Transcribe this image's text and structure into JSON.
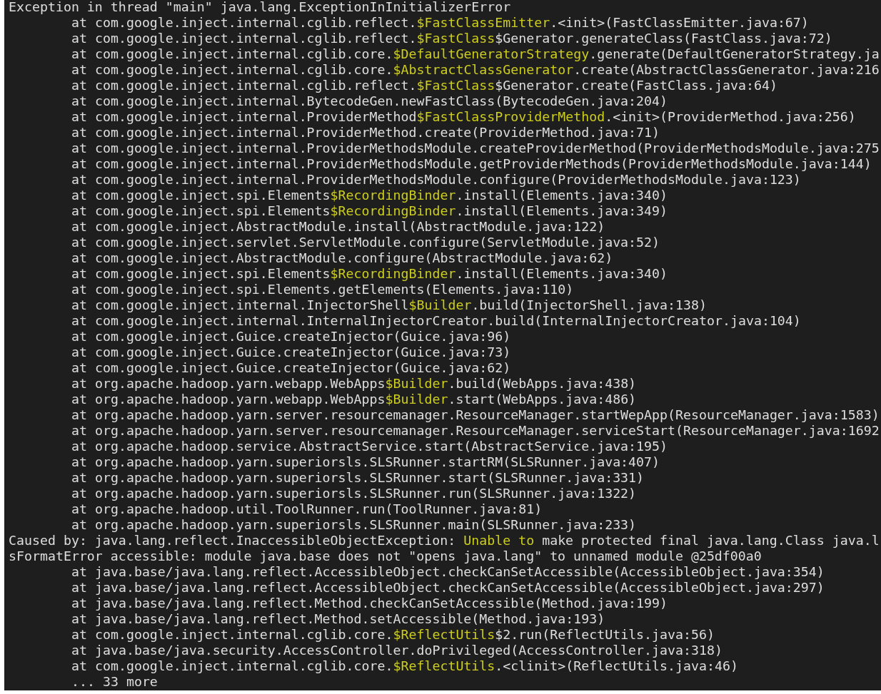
{
  "terminal": {
    "lines": [
      {
        "kind": "header",
        "parts": [
          {
            "text": "Exception in thread \"main\" java.lang.ExceptionInInitializerError",
            "highlight": false
          }
        ]
      },
      {
        "kind": "frame",
        "parts": [
          {
            "text": "at com.google.inject.internal.cglib.reflect.",
            "highlight": false
          },
          {
            "text": "$FastClassEmitter",
            "highlight": true
          },
          {
            "text": ".<init>(FastClassEmitter.java:67)",
            "highlight": false
          }
        ]
      },
      {
        "kind": "frame",
        "parts": [
          {
            "text": "at com.google.inject.internal.cglib.reflect.",
            "highlight": false
          },
          {
            "text": "$FastClass",
            "highlight": true
          },
          {
            "text": "$Generator.generateClass(FastClass.java:72)",
            "highlight": false
          }
        ]
      },
      {
        "kind": "frame",
        "parts": [
          {
            "text": "at com.google.inject.internal.cglib.core.",
            "highlight": false
          },
          {
            "text": "$DefaultGeneratorStrategy",
            "highlight": true
          },
          {
            "text": ".generate(DefaultGeneratorStrategy.ja",
            "highlight": false
          }
        ]
      },
      {
        "kind": "frame",
        "parts": [
          {
            "text": "at com.google.inject.internal.cglib.core.",
            "highlight": false
          },
          {
            "text": "$AbstractClassGenerator",
            "highlight": true
          },
          {
            "text": ".create(AbstractClassGenerator.java:216",
            "highlight": false
          }
        ]
      },
      {
        "kind": "frame",
        "parts": [
          {
            "text": "at com.google.inject.internal.cglib.reflect.",
            "highlight": false
          },
          {
            "text": "$FastClass",
            "highlight": true
          },
          {
            "text": "$Generator.create(FastClass.java:64)",
            "highlight": false
          }
        ]
      },
      {
        "kind": "frame",
        "parts": [
          {
            "text": "at com.google.inject.internal.BytecodeGen.newFastClass(BytecodeGen.java:204)",
            "highlight": false
          }
        ]
      },
      {
        "kind": "frame",
        "parts": [
          {
            "text": "at com.google.inject.internal.ProviderMethod",
            "highlight": false
          },
          {
            "text": "$FastClassProviderMethod",
            "highlight": true
          },
          {
            "text": ".<init>(ProviderMethod.java:256)",
            "highlight": false
          }
        ]
      },
      {
        "kind": "frame",
        "parts": [
          {
            "text": "at com.google.inject.internal.ProviderMethod.create(ProviderMethod.java:71)",
            "highlight": false
          }
        ]
      },
      {
        "kind": "frame",
        "parts": [
          {
            "text": "at com.google.inject.internal.ProviderMethodsModule.createProviderMethod(ProviderMethodsModule.java:275",
            "highlight": false
          }
        ]
      },
      {
        "kind": "frame",
        "parts": [
          {
            "text": "at com.google.inject.internal.ProviderMethodsModule.getProviderMethods(ProviderMethodsModule.java:144)",
            "highlight": false
          }
        ]
      },
      {
        "kind": "frame",
        "parts": [
          {
            "text": "at com.google.inject.internal.ProviderMethodsModule.configure(ProviderMethodsModule.java:123)",
            "highlight": false
          }
        ]
      },
      {
        "kind": "frame",
        "parts": [
          {
            "text": "at com.google.inject.spi.Elements",
            "highlight": false
          },
          {
            "text": "$RecordingBinder",
            "highlight": true
          },
          {
            "text": ".install(Elements.java:340)",
            "highlight": false
          }
        ]
      },
      {
        "kind": "frame",
        "parts": [
          {
            "text": "at com.google.inject.spi.Elements",
            "highlight": false
          },
          {
            "text": "$RecordingBinder",
            "highlight": true
          },
          {
            "text": ".install(Elements.java:349)",
            "highlight": false
          }
        ]
      },
      {
        "kind": "frame",
        "parts": [
          {
            "text": "at com.google.inject.AbstractModule.install(AbstractModule.java:122)",
            "highlight": false
          }
        ]
      },
      {
        "kind": "frame",
        "parts": [
          {
            "text": "at com.google.inject.servlet.ServletModule.configure(ServletModule.java:52)",
            "highlight": false
          }
        ]
      },
      {
        "kind": "frame",
        "parts": [
          {
            "text": "at com.google.inject.AbstractModule.configure(AbstractModule.java:62)",
            "highlight": false
          }
        ]
      },
      {
        "kind": "frame",
        "parts": [
          {
            "text": "at com.google.inject.spi.Elements",
            "highlight": false
          },
          {
            "text": "$RecordingBinder",
            "highlight": true
          },
          {
            "text": ".install(Elements.java:340)",
            "highlight": false
          }
        ]
      },
      {
        "kind": "frame",
        "parts": [
          {
            "text": "at com.google.inject.spi.Elements.getElements(Elements.java:110)",
            "highlight": false
          }
        ]
      },
      {
        "kind": "frame",
        "parts": [
          {
            "text": "at com.google.inject.internal.InjectorShell",
            "highlight": false
          },
          {
            "text": "$Builder",
            "highlight": true
          },
          {
            "text": ".build(InjectorShell.java:138)",
            "highlight": false
          }
        ]
      },
      {
        "kind": "frame",
        "parts": [
          {
            "text": "at com.google.inject.internal.InternalInjectorCreator.build(InternalInjectorCreator.java:104)",
            "highlight": false
          }
        ]
      },
      {
        "kind": "frame",
        "parts": [
          {
            "text": "at com.google.inject.Guice.createInjector(Guice.java:96)",
            "highlight": false
          }
        ]
      },
      {
        "kind": "frame",
        "parts": [
          {
            "text": "at com.google.inject.Guice.createInjector(Guice.java:73)",
            "highlight": false
          }
        ]
      },
      {
        "kind": "frame",
        "parts": [
          {
            "text": "at com.google.inject.Guice.createInjector(Guice.java:62)",
            "highlight": false
          }
        ]
      },
      {
        "kind": "frame",
        "parts": [
          {
            "text": "at org.apache.hadoop.yarn.webapp.WebApps",
            "highlight": false
          },
          {
            "text": "$Builder",
            "highlight": true
          },
          {
            "text": ".build(WebApps.java:438)",
            "highlight": false
          }
        ]
      },
      {
        "kind": "frame",
        "parts": [
          {
            "text": "at org.apache.hadoop.yarn.webapp.WebApps",
            "highlight": false
          },
          {
            "text": "$Builder",
            "highlight": true
          },
          {
            "text": ".start(WebApps.java:486)",
            "highlight": false
          }
        ]
      },
      {
        "kind": "frame",
        "parts": [
          {
            "text": "at org.apache.hadoop.yarn.server.resourcemanager.ResourceManager.startWepApp(ResourceManager.java:1583)",
            "highlight": false
          }
        ]
      },
      {
        "kind": "frame",
        "parts": [
          {
            "text": "at org.apache.hadoop.yarn.server.resourcemanager.ResourceManager.serviceStart(ResourceManager.java:1692",
            "highlight": false
          }
        ]
      },
      {
        "kind": "frame",
        "parts": [
          {
            "text": "at org.apache.hadoop.service.AbstractService.start(AbstractService.java:195)",
            "highlight": false
          }
        ]
      },
      {
        "kind": "frame",
        "parts": [
          {
            "text": "at org.apache.hadoop.yarn.superiorsls.SLSRunner.startRM(SLSRunner.java:407)",
            "highlight": false
          }
        ]
      },
      {
        "kind": "frame",
        "parts": [
          {
            "text": "at org.apache.hadoop.yarn.superiorsls.SLSRunner.start(SLSRunner.java:331)",
            "highlight": false
          }
        ]
      },
      {
        "kind": "frame",
        "parts": [
          {
            "text": "at org.apache.hadoop.yarn.superiorsls.SLSRunner.run(SLSRunner.java:1322)",
            "highlight": false
          }
        ]
      },
      {
        "kind": "frame",
        "parts": [
          {
            "text": "at org.apache.hadoop.util.ToolRunner.run(ToolRunner.java:81)",
            "highlight": false
          }
        ]
      },
      {
        "kind": "frame",
        "parts": [
          {
            "text": "at org.apache.hadoop.yarn.superiorsls.SLSRunner.main(SLSRunner.java:233)",
            "highlight": false
          }
        ]
      },
      {
        "kind": "header",
        "parts": [
          {
            "text": "Caused by: java.lang.reflect.InaccessibleObjectException: ",
            "highlight": false
          },
          {
            "text": "Unable to",
            "highlight": true
          },
          {
            "text": " make protected final java.lang.Class java.l",
            "highlight": false
          }
        ]
      },
      {
        "kind": "header",
        "parts": [
          {
            "text": "sFormatError accessible: module java.base does not \"opens java.lang\" to unnamed module @25df00a0",
            "highlight": false
          }
        ]
      },
      {
        "kind": "frame",
        "parts": [
          {
            "text": "at java.base/java.lang.reflect.AccessibleObject.checkCanSetAccessible(AccessibleObject.java:354)",
            "highlight": false
          }
        ]
      },
      {
        "kind": "frame",
        "parts": [
          {
            "text": "at java.base/java.lang.reflect.AccessibleObject.checkCanSetAccessible(AccessibleObject.java:297)",
            "highlight": false
          }
        ]
      },
      {
        "kind": "frame",
        "parts": [
          {
            "text": "at java.base/java.lang.reflect.Method.checkCanSetAccessible(Method.java:199)",
            "highlight": false
          }
        ]
      },
      {
        "kind": "frame",
        "parts": [
          {
            "text": "at java.base/java.lang.reflect.Method.setAccessible(Method.java:193)",
            "highlight": false
          }
        ]
      },
      {
        "kind": "frame",
        "parts": [
          {
            "text": "at com.google.inject.internal.cglib.core.",
            "highlight": false
          },
          {
            "text": "$ReflectUtils",
            "highlight": true
          },
          {
            "text": "$2.run(ReflectUtils.java:56)",
            "highlight": false
          }
        ]
      },
      {
        "kind": "frame",
        "parts": [
          {
            "text": "at java.base/java.security.AccessController.doPrivileged(AccessController.java:318)",
            "highlight": false
          }
        ]
      },
      {
        "kind": "frame",
        "parts": [
          {
            "text": "at com.google.inject.internal.cglib.core.",
            "highlight": false
          },
          {
            "text": "$ReflectUtils",
            "highlight": true
          },
          {
            "text": ".<clinit>(ReflectUtils.java:46)",
            "highlight": false
          }
        ]
      },
      {
        "kind": "frame",
        "parts": [
          {
            "text": "... 33 more",
            "highlight": false
          }
        ]
      }
    ]
  }
}
